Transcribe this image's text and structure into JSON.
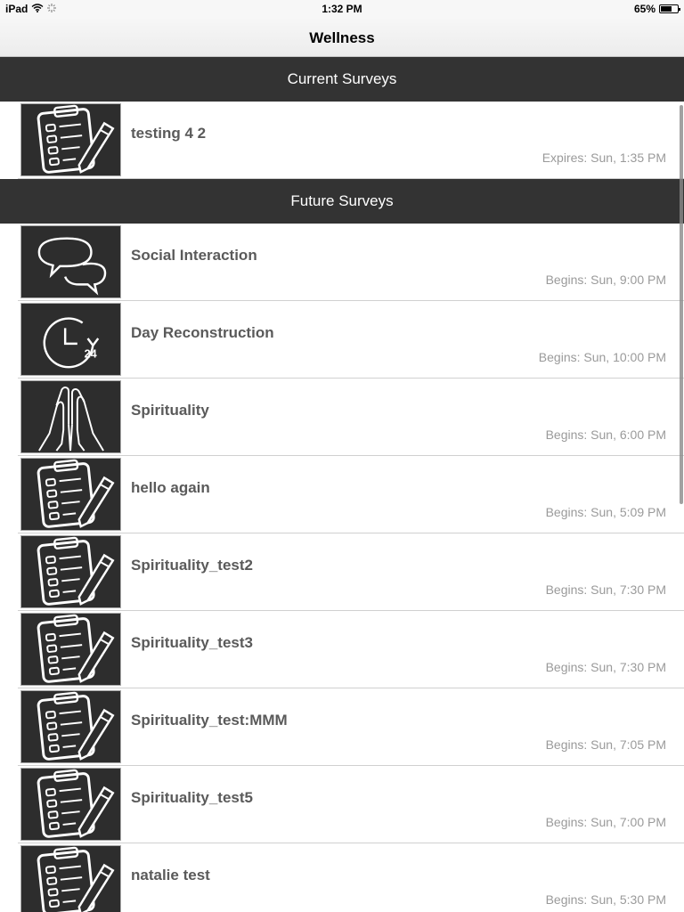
{
  "statusbar": {
    "device": "iPad",
    "time": "1:32 PM",
    "battery": "65%",
    "battery_level": 0.65
  },
  "navbar": {
    "title": "Wellness"
  },
  "sections": {
    "current": {
      "header": "Current Surveys",
      "items": [
        {
          "name": "testing 4 2",
          "time": "Expires: Sun, 1:35 PM",
          "icon": "clipboard-icon"
        }
      ]
    },
    "future": {
      "header": "Future Surveys",
      "items": [
        {
          "name": "Social Interaction",
          "time": "Begins: Sun, 9:00 PM",
          "icon": "speech-bubbles-icon"
        },
        {
          "name": "Day Reconstruction",
          "time": "Begins: Sun, 10:00 PM",
          "icon": "clock-24-icon",
          "icon_label": "24"
        },
        {
          "name": "Spirituality",
          "time": "Begins: Sun, 6:00 PM",
          "icon": "praying-hands-icon"
        },
        {
          "name": "hello again",
          "time": "Begins: Sun, 5:09 PM",
          "icon": "clipboard-icon"
        },
        {
          "name": "Spirituality_test2",
          "time": "Begins: Sun, 7:30 PM",
          "icon": "clipboard-icon"
        },
        {
          "name": "Spirituality_test3",
          "time": "Begins: Sun, 7:30 PM",
          "icon": "clipboard-icon"
        },
        {
          "name": "Spirituality_test:MMM",
          "time": "Begins: Sun, 7:05 PM",
          "icon": "clipboard-icon"
        },
        {
          "name": "Spirituality_test5",
          "time": "Begins: Sun, 7:00 PM",
          "icon": "clipboard-icon"
        },
        {
          "name": "natalie test",
          "time": "Begins: Sun, 5:30 PM",
          "icon": "clipboard-icon"
        }
      ]
    }
  }
}
